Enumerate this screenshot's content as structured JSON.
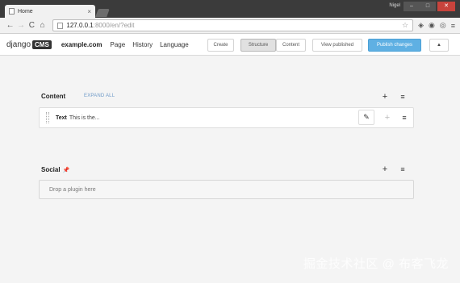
{
  "browser": {
    "tab_title": "Home",
    "user_label": "Nigel",
    "address_host": "127.0.0.1",
    "address_path": ":8000/en/?edit",
    "window_buttons": [
      "‒",
      "□",
      "✕"
    ]
  },
  "cms_toolbar": {
    "logo_text": "django",
    "logo_badge": "CMS",
    "site": "example.com",
    "menu": [
      "Page",
      "History",
      "Language"
    ],
    "buttons": {
      "create": "Create",
      "structure": "Structure",
      "content": "Content",
      "view_published": "View published",
      "publish_changes": "Publish changes"
    }
  },
  "placeholders": [
    {
      "title": "Content",
      "expand_label": "EXPAND ALL",
      "plugins": [
        {
          "name": "Text",
          "description": "This is the..."
        }
      ]
    },
    {
      "title": "Social",
      "dropzone_label": "Drop a plugin here"
    }
  ],
  "watermark": "掘金技术社区 @ 布客飞龙",
  "colors": {
    "publish": "#5fb0e3",
    "expand_link": "#6f9bc8",
    "close_button": "#c7433c"
  }
}
